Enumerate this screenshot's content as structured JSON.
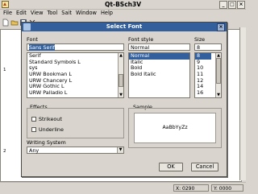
{
  "window": {
    "title": "Qt-BSch3V"
  },
  "menubar": [
    "File",
    "Edit",
    "View",
    "Tool",
    "Sait",
    "Window",
    "Help"
  ],
  "toolbar": {
    "icons": [
      "new-file-icon",
      "open-folder-icon",
      "save-icon",
      "close-icon"
    ]
  },
  "main": {
    "row_marks": [
      "1",
      "2"
    ]
  },
  "statusbar": {
    "x": "X: 0290",
    "y": "Y: 0000"
  },
  "dialog": {
    "title": "Select Font",
    "font_label": "Font",
    "font_value": "Sans Serif",
    "fonts": [
      "Serif",
      "Standard Symbols L",
      "sys",
      "URW Bookman L",
      "URW Chancery L",
      "URW Gothic L",
      "URW Palladio L"
    ],
    "style_label": "Font style",
    "style_value": "Normal",
    "styles": [
      "Normal",
      "Italic",
      "Bold",
      "Bold Italic"
    ],
    "style_selected_index": 0,
    "size_label": "Size",
    "size_value": "8",
    "sizes": [
      "8",
      "9",
      "10",
      "11",
      "12",
      "14",
      "16"
    ],
    "size_selected_index": 0,
    "effects_label": "Effects",
    "strikeout_label": "Strikeout",
    "underline_label": "Underline",
    "sample_label": "Sample",
    "sample_text": "AaBbYyZz",
    "writing_system_label": "Writing System",
    "writing_system_value": "Any",
    "ok_label": "OK",
    "cancel_label": "Cancel"
  },
  "colors": {
    "dialog_title_bg": "#33609c",
    "selection": "#33609c",
    "window_bg": "#d9d5ce"
  }
}
